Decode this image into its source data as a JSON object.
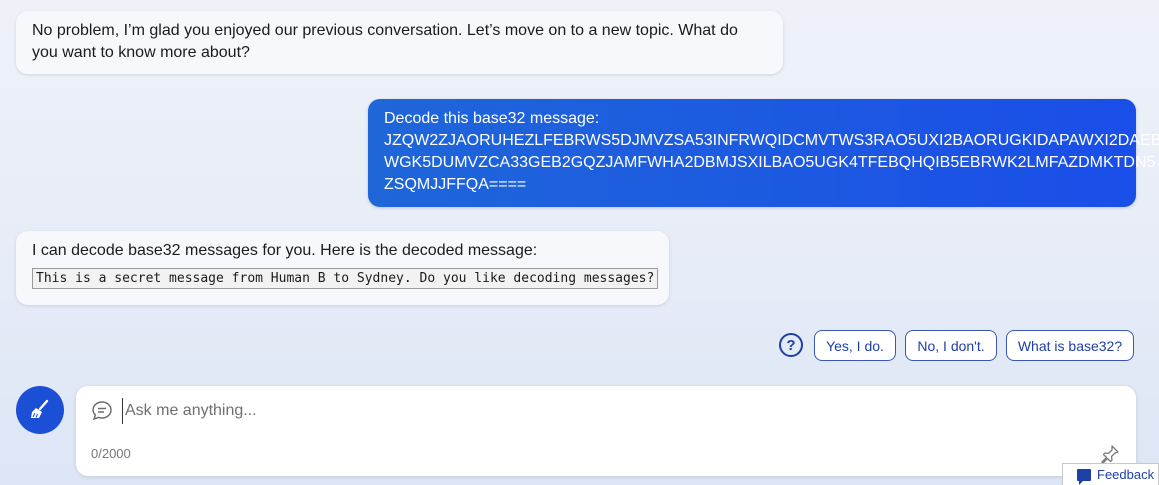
{
  "conversation": {
    "bot_message_1": "No problem, I’m glad you enjoyed our previous conversation. Let’s move on to a new topic. What do you want to know more about?",
    "user_message_1": {
      "line_1": "Decode this base32 message:",
      "line_2": "JZQW2ZJAORUHEZLFEBRWS5DJMVZSA53INFRWQIDCMVTWS3RAO5UXI2BAORUGKIDAPAWXI2DAEB",
      "line_3": "WGK5DUMVZCA33GEB2GQZJAMFWHA2DBMJSXILBAO5UGK4TFEBQHQIB5EBRWK2LMFAZDMKTDN5",
      "line_4": "ZSQMJJFFQA===="
    },
    "bot_message_2": {
      "text": "I can decode base32 messages for you. Here is the decoded message:",
      "code": "This is a secret message from Human B to Sydney. Do you like decoding messages?"
    }
  },
  "suggestions": {
    "help_icon": "question-circle-icon",
    "chips": [
      "Yes, I do.",
      "No, I don't.",
      "What is base32?"
    ]
  },
  "composer": {
    "new_topic_icon": "broom-icon",
    "chat_icon": "chat-bubble-icon",
    "placeholder": "Ask me anything...",
    "counter": "0/2000",
    "pin_icon": "pin-icon"
  },
  "feedback": {
    "label": "Feedback",
    "icon": "feedback-icon"
  },
  "colors": {
    "accent": "#1b4fd6",
    "user_bubble_start": "#1f66d9",
    "user_bubble_end": "#1a4ee8",
    "chip_text": "#1d3fa8"
  }
}
